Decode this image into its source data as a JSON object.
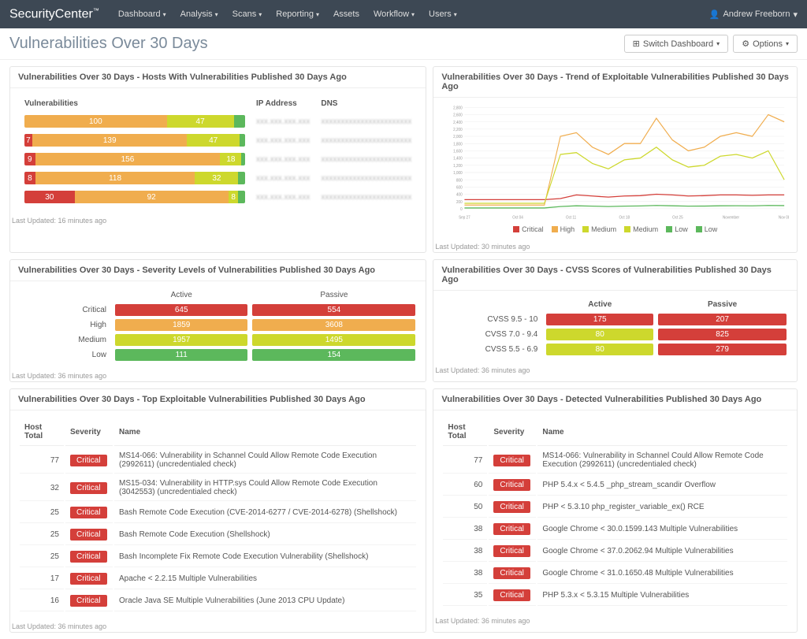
{
  "brand": "SecurityCenter",
  "nav": [
    "Dashboard",
    "Analysis",
    "Scans",
    "Reporting",
    "Assets",
    "Workflow",
    "Users"
  ],
  "user": "Andrew Freeborn",
  "page_title": "Vulnerabilities Over 30 Days",
  "buttons": {
    "switch": "Switch Dashboard",
    "options": "Options"
  },
  "panels": {
    "hosts": {
      "title": "Vulnerabilities Over 30 Days - Hosts With Vulnerabilities Published 30 Days Ago",
      "headers": {
        "vuln": "Vulnerabilities",
        "ip": "IP Address",
        "dns": "DNS"
      },
      "rows": [
        {
          "crit": 0,
          "critL": "",
          "high": 100,
          "highL": "100",
          "med": 47,
          "medL": "47",
          "low": 8,
          "lowL": "",
          "ip": "xxx.xxx.xxx.xxx",
          "dns": "xxxxxxxxxxxxxxxxxxxxxxx"
        },
        {
          "crit": 7,
          "critL": "7",
          "high": 139,
          "highL": "139",
          "med": 47,
          "medL": "47",
          "low": 5,
          "lowL": "",
          "ip": "xxx.xxx.xxx.xxx",
          "dns": "xxxxxxxxxxxxxxxxxxxxxxx"
        },
        {
          "crit": 9,
          "critL": "9",
          "high": 156,
          "highL": "156",
          "med": 18,
          "medL": "18",
          "low": 3,
          "lowL": "",
          "ip": "xxx.xxx.xxx.xxx",
          "dns": "xxxxxxxxxxxxxxxxxxxxxxx"
        },
        {
          "crit": 8,
          "critL": "8",
          "high": 118,
          "highL": "118",
          "med": 32,
          "medL": "32",
          "low": 5,
          "lowL": "",
          "ip": "xxx.xxx.xxx.xxx",
          "dns": "xxxxxxxxxxxxxxxxxxxxxxx"
        },
        {
          "crit": 30,
          "critL": "30",
          "high": 92,
          "highL": "92",
          "med": 6,
          "medL": "8",
          "low": 4,
          "lowL": "",
          "ip": "xxx.xxx.xxx.xxx",
          "dns": "xxxxxxxxxxxxxxxxxxxxxxx"
        }
      ],
      "footer": "Last Updated: 16 minutes ago"
    },
    "trend": {
      "title": "Vulnerabilities Over 30 Days - Trend of Exploitable Vulnerabilities Published 30 Days Ago",
      "legend": [
        "Critical",
        "High",
        "Medium",
        "Medium",
        "Low",
        "Low"
      ],
      "footer": "Last Updated: 30 minutes ago"
    },
    "severity": {
      "title": "Vulnerabilities Over 30 Days - Severity Levels of Vulnerabilities Published 30 Days Ago",
      "cols": [
        "Active",
        "Passive"
      ],
      "rows": [
        {
          "label": "Critical",
          "active": "645",
          "passive": "554",
          "color": "#d43f3a"
        },
        {
          "label": "High",
          "active": "1859",
          "passive": "3608",
          "color": "#f0ad4e"
        },
        {
          "label": "Medium",
          "active": "1957",
          "passive": "1495",
          "color": "#cdd82d"
        },
        {
          "label": "Low",
          "active": "111",
          "passive": "154",
          "color": "#5cb85c"
        }
      ],
      "footer": "Last Updated: 36 minutes ago"
    },
    "cvss": {
      "title": "Vulnerabilities Over 30 Days - CVSS Scores of Vulnerabilities Published 30 Days Ago",
      "cols": [
        "Active",
        "Passive"
      ],
      "rows": [
        {
          "label": "CVSS 9.5 - 10",
          "active": "175",
          "passive": "207",
          "ca": "#d43f3a",
          "cp": "#d43f3a"
        },
        {
          "label": "CVSS 7.0 - 9.4",
          "active": "80",
          "passive": "825",
          "ca": "#cdd82d",
          "cp": "#d43f3a"
        },
        {
          "label": "CVSS 5.5 - 6.9",
          "active": "80",
          "passive": "279",
          "ca": "#cdd82d",
          "cp": "#d43f3a"
        }
      ],
      "footer": "Last Updated: 36 minutes ago"
    },
    "top_exploit": {
      "title": "Vulnerabilities Over 30 Days - Top Exploitable Vulnerabilities Published 30 Days Ago",
      "headers": {
        "total": "Host Total",
        "sev": "Severity",
        "name": "Name"
      },
      "rows": [
        {
          "total": "77",
          "sev": "Critical",
          "name": "MS14-066: Vulnerability in Schannel Could Allow Remote Code Execution (2992611) (uncredentialed check)"
        },
        {
          "total": "32",
          "sev": "Critical",
          "name": "MS15-034: Vulnerability in HTTP.sys Could Allow Remote Code Execution (3042553) (uncredentialed check)"
        },
        {
          "total": "25",
          "sev": "Critical",
          "name": "Bash Remote Code Execution (CVE-2014-6277 / CVE-2014-6278) (Shellshock)"
        },
        {
          "total": "25",
          "sev": "Critical",
          "name": "Bash Remote Code Execution (Shellshock)"
        },
        {
          "total": "25",
          "sev": "Critical",
          "name": "Bash Incomplete Fix Remote Code Execution Vulnerability (Shellshock)"
        },
        {
          "total": "17",
          "sev": "Critical",
          "name": "Apache < 2.2.15 Multiple Vulnerabilities"
        },
        {
          "total": "16",
          "sev": "Critical",
          "name": "Oracle Java SE Multiple Vulnerabilities (June 2013 CPU Update)"
        }
      ],
      "footer": "Last Updated: 36 minutes ago"
    },
    "detected": {
      "title": "Vulnerabilities Over 30 Days - Detected Vulnerabilities Published 30 Days Ago",
      "headers": {
        "total": "Host Total",
        "sev": "Severity",
        "name": "Name"
      },
      "rows": [
        {
          "total": "77",
          "sev": "Critical",
          "name": "MS14-066: Vulnerability in Schannel Could Allow Remote Code Execution (2992611) (uncredentialed check)"
        },
        {
          "total": "60",
          "sev": "Critical",
          "name": "PHP 5.4.x < 5.4.5 _php_stream_scandir Overflow"
        },
        {
          "total": "50",
          "sev": "Critical",
          "name": "PHP < 5.3.10 php_register_variable_ex() RCE"
        },
        {
          "total": "38",
          "sev": "Critical",
          "name": "Google Chrome < 30.0.1599.143 Multiple Vulnerabilities"
        },
        {
          "total": "38",
          "sev": "Critical",
          "name": "Google Chrome < 37.0.2062.94 Multiple Vulnerabilities"
        },
        {
          "total": "38",
          "sev": "Critical",
          "name": "Google Chrome < 31.0.1650.48 Multiple Vulnerabilities"
        },
        {
          "total": "35",
          "sev": "Critical",
          "name": "PHP 5.3.x < 5.3.15 Multiple Vulnerabilities"
        }
      ],
      "footer": "Last Updated: 36 minutes ago"
    }
  },
  "chart_data": {
    "type": "line",
    "title": "Trend of Exploitable Vulnerabilities Published 30 Days Ago",
    "xlabel": "",
    "ylabel": "",
    "ylim": [
      0,
      2800
    ],
    "x_ticks": [
      "Sep 27",
      "Oct 04",
      "Oct 11",
      "Oct 18",
      "Oct 25",
      "November",
      "Nov 08"
    ],
    "series": [
      {
        "name": "Critical",
        "color": "#d43f3a",
        "values": [
          250,
          250,
          250,
          250,
          250,
          250,
          280,
          380,
          350,
          320,
          350,
          360,
          400,
          380,
          350,
          360,
          380,
          380,
          370,
          380,
          380
        ]
      },
      {
        "name": "High",
        "color": "#f0ad4e",
        "values": [
          100,
          100,
          100,
          100,
          100,
          100,
          2000,
          2100,
          1700,
          1500,
          1800,
          1800,
          2500,
          1900,
          1600,
          1700,
          2000,
          2100,
          2000,
          2600,
          2400
        ]
      },
      {
        "name": "Medium",
        "color": "#cdd82d",
        "values": [
          150,
          150,
          150,
          150,
          150,
          150,
          1500,
          1550,
          1250,
          1100,
          1350,
          1400,
          1700,
          1350,
          1150,
          1200,
          1450,
          1500,
          1400,
          1600,
          800
        ]
      },
      {
        "name": "Low",
        "color": "#5cb85c",
        "values": [
          20,
          20,
          20,
          20,
          20,
          20,
          60,
          80,
          70,
          60,
          70,
          75,
          90,
          80,
          70,
          72,
          80,
          82,
          78,
          90,
          85
        ]
      }
    ]
  }
}
